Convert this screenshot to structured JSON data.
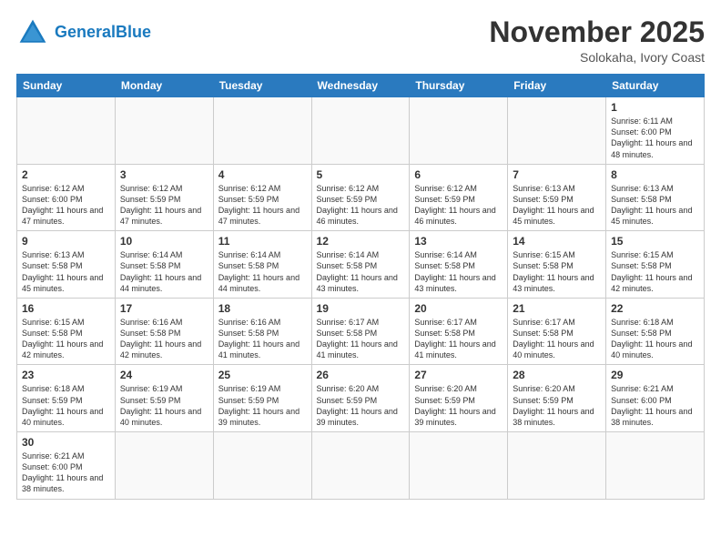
{
  "logo": {
    "general": "General",
    "blue": "Blue"
  },
  "header": {
    "month_year": "November 2025",
    "location": "Solokaha, Ivory Coast"
  },
  "days_of_week": [
    "Sunday",
    "Monday",
    "Tuesday",
    "Wednesday",
    "Thursday",
    "Friday",
    "Saturday"
  ],
  "weeks": [
    [
      {
        "day": "",
        "info": ""
      },
      {
        "day": "",
        "info": ""
      },
      {
        "day": "",
        "info": ""
      },
      {
        "day": "",
        "info": ""
      },
      {
        "day": "",
        "info": ""
      },
      {
        "day": "",
        "info": ""
      },
      {
        "day": "1",
        "info": "Sunrise: 6:11 AM\nSunset: 6:00 PM\nDaylight: 11 hours and 48 minutes."
      }
    ],
    [
      {
        "day": "2",
        "info": "Sunrise: 6:12 AM\nSunset: 6:00 PM\nDaylight: 11 hours and 47 minutes."
      },
      {
        "day": "3",
        "info": "Sunrise: 6:12 AM\nSunset: 5:59 PM\nDaylight: 11 hours and 47 minutes."
      },
      {
        "day": "4",
        "info": "Sunrise: 6:12 AM\nSunset: 5:59 PM\nDaylight: 11 hours and 47 minutes."
      },
      {
        "day": "5",
        "info": "Sunrise: 6:12 AM\nSunset: 5:59 PM\nDaylight: 11 hours and 46 minutes."
      },
      {
        "day": "6",
        "info": "Sunrise: 6:12 AM\nSunset: 5:59 PM\nDaylight: 11 hours and 46 minutes."
      },
      {
        "day": "7",
        "info": "Sunrise: 6:13 AM\nSunset: 5:59 PM\nDaylight: 11 hours and 45 minutes."
      },
      {
        "day": "8",
        "info": "Sunrise: 6:13 AM\nSunset: 5:58 PM\nDaylight: 11 hours and 45 minutes."
      }
    ],
    [
      {
        "day": "9",
        "info": "Sunrise: 6:13 AM\nSunset: 5:58 PM\nDaylight: 11 hours and 45 minutes."
      },
      {
        "day": "10",
        "info": "Sunrise: 6:14 AM\nSunset: 5:58 PM\nDaylight: 11 hours and 44 minutes."
      },
      {
        "day": "11",
        "info": "Sunrise: 6:14 AM\nSunset: 5:58 PM\nDaylight: 11 hours and 44 minutes."
      },
      {
        "day": "12",
        "info": "Sunrise: 6:14 AM\nSunset: 5:58 PM\nDaylight: 11 hours and 43 minutes."
      },
      {
        "day": "13",
        "info": "Sunrise: 6:14 AM\nSunset: 5:58 PM\nDaylight: 11 hours and 43 minutes."
      },
      {
        "day": "14",
        "info": "Sunrise: 6:15 AM\nSunset: 5:58 PM\nDaylight: 11 hours and 43 minutes."
      },
      {
        "day": "15",
        "info": "Sunrise: 6:15 AM\nSunset: 5:58 PM\nDaylight: 11 hours and 42 minutes."
      }
    ],
    [
      {
        "day": "16",
        "info": "Sunrise: 6:15 AM\nSunset: 5:58 PM\nDaylight: 11 hours and 42 minutes."
      },
      {
        "day": "17",
        "info": "Sunrise: 6:16 AM\nSunset: 5:58 PM\nDaylight: 11 hours and 42 minutes."
      },
      {
        "day": "18",
        "info": "Sunrise: 6:16 AM\nSunset: 5:58 PM\nDaylight: 11 hours and 41 minutes."
      },
      {
        "day": "19",
        "info": "Sunrise: 6:17 AM\nSunset: 5:58 PM\nDaylight: 11 hours and 41 minutes."
      },
      {
        "day": "20",
        "info": "Sunrise: 6:17 AM\nSunset: 5:58 PM\nDaylight: 11 hours and 41 minutes."
      },
      {
        "day": "21",
        "info": "Sunrise: 6:17 AM\nSunset: 5:58 PM\nDaylight: 11 hours and 40 minutes."
      },
      {
        "day": "22",
        "info": "Sunrise: 6:18 AM\nSunset: 5:58 PM\nDaylight: 11 hours and 40 minutes."
      }
    ],
    [
      {
        "day": "23",
        "info": "Sunrise: 6:18 AM\nSunset: 5:59 PM\nDaylight: 11 hours and 40 minutes."
      },
      {
        "day": "24",
        "info": "Sunrise: 6:19 AM\nSunset: 5:59 PM\nDaylight: 11 hours and 40 minutes."
      },
      {
        "day": "25",
        "info": "Sunrise: 6:19 AM\nSunset: 5:59 PM\nDaylight: 11 hours and 39 minutes."
      },
      {
        "day": "26",
        "info": "Sunrise: 6:20 AM\nSunset: 5:59 PM\nDaylight: 11 hours and 39 minutes."
      },
      {
        "day": "27",
        "info": "Sunrise: 6:20 AM\nSunset: 5:59 PM\nDaylight: 11 hours and 39 minutes."
      },
      {
        "day": "28",
        "info": "Sunrise: 6:20 AM\nSunset: 5:59 PM\nDaylight: 11 hours and 38 minutes."
      },
      {
        "day": "29",
        "info": "Sunrise: 6:21 AM\nSunset: 6:00 PM\nDaylight: 11 hours and 38 minutes."
      }
    ],
    [
      {
        "day": "30",
        "info": "Sunrise: 6:21 AM\nSunset: 6:00 PM\nDaylight: 11 hours and 38 minutes."
      },
      {
        "day": "",
        "info": ""
      },
      {
        "day": "",
        "info": ""
      },
      {
        "day": "",
        "info": ""
      },
      {
        "day": "",
        "info": ""
      },
      {
        "day": "",
        "info": ""
      },
      {
        "day": "",
        "info": ""
      }
    ]
  ]
}
